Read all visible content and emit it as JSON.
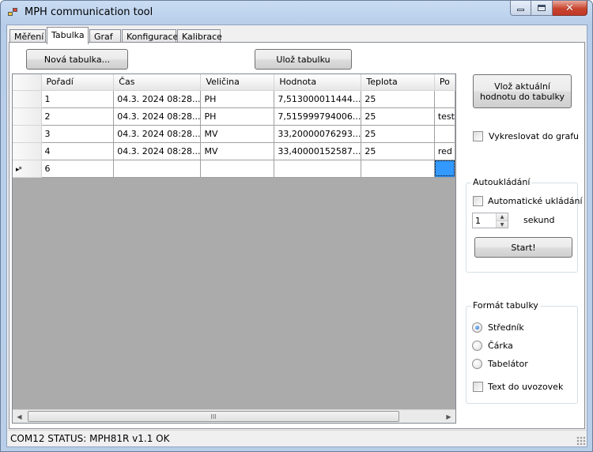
{
  "window": {
    "title": "MPH communication tool"
  },
  "tabs": [
    {
      "label": "Měření"
    },
    {
      "label": "Tabulka"
    },
    {
      "label": "Graf"
    },
    {
      "label": "Konfigurace"
    },
    {
      "label": "Kalibrace"
    }
  ],
  "toolbar": {
    "new_table": "Nová tabulka...",
    "save_table": "Ulož tabulku"
  },
  "table": {
    "columns": [
      "Pořadí",
      "Čas",
      "Veličina",
      "Hodnota",
      "Teplota",
      "Po"
    ],
    "rows": [
      [
        "1",
        "04.3. 2024 08:28...",
        "PH",
        "7,513000011444...",
        "25",
        ""
      ],
      [
        "2",
        "04.3. 2024 08:28...",
        "PH",
        "7,515999794006...",
        "25",
        "test"
      ],
      [
        "3",
        "04.3. 2024 08:28...",
        "MV",
        "33,20000076293...",
        "25",
        ""
      ],
      [
        "4",
        "04.3. 2024 08:28...",
        "MV",
        "33,40000152587...",
        "25",
        "red"
      ]
    ],
    "new_row": {
      "marker": "▸*",
      "order": "6"
    },
    "scroll_thumb": "III"
  },
  "side": {
    "insert_button": "Vlož aktuální hodnotu do tabulky",
    "plot_checkbox": "Vykreslovat do grafu",
    "autosave": {
      "title": "Autoukládání",
      "checkbox": "Automatické ukládání",
      "seconds_value": "1",
      "seconds_label": "sekund",
      "start_button": "Start!"
    },
    "format": {
      "title": "Formát tabulky",
      "options": [
        "Středník",
        "Čárka",
        "Tabelátor"
      ],
      "selected": "Středník",
      "quotes_checkbox": "Text do uvozovek"
    }
  },
  "status": {
    "text": "COM12  STATUS: MPH81R v1.1 OK"
  }
}
